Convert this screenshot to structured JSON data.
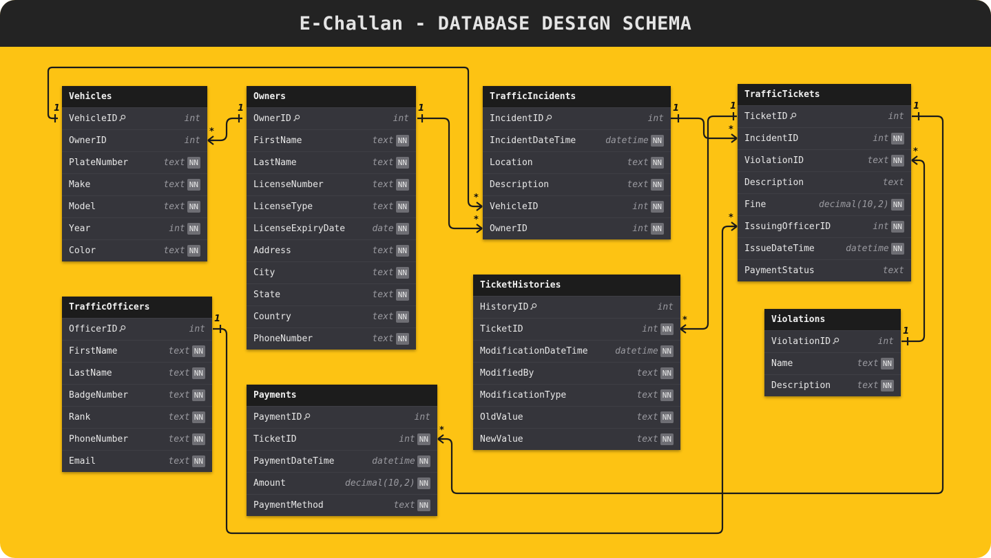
{
  "title": "E-Challan - DATABASE DESIGN SCHEMA",
  "colors": {
    "background": "#fdc313",
    "titlebar": "#232323",
    "table_body": "#35353b",
    "table_header": "#1c1c1c",
    "line": "#1a1a1a"
  },
  "key_icon": "key-icon",
  "nn_label": "NN",
  "tables": {
    "vehicles": {
      "name": "Vehicles",
      "fields": [
        {
          "name": "VehicleID",
          "type": "int",
          "pk": true,
          "nn": false
        },
        {
          "name": "OwnerID",
          "type": "int",
          "pk": false,
          "nn": false
        },
        {
          "name": "PlateNumber",
          "type": "text",
          "pk": false,
          "nn": true
        },
        {
          "name": "Make",
          "type": "text",
          "pk": false,
          "nn": true
        },
        {
          "name": "Model",
          "type": "text",
          "pk": false,
          "nn": true
        },
        {
          "name": "Year",
          "type": "int",
          "pk": false,
          "nn": true
        },
        {
          "name": "Color",
          "type": "text",
          "pk": false,
          "nn": true
        }
      ]
    },
    "owners": {
      "name": "Owners",
      "fields": [
        {
          "name": "OwnerID",
          "type": "int",
          "pk": true,
          "nn": false
        },
        {
          "name": "FirstName",
          "type": "text",
          "pk": false,
          "nn": true
        },
        {
          "name": "LastName",
          "type": "text",
          "pk": false,
          "nn": true
        },
        {
          "name": "LicenseNumber",
          "type": "text",
          "pk": false,
          "nn": true
        },
        {
          "name": "LicenseType",
          "type": "text",
          "pk": false,
          "nn": true
        },
        {
          "name": "LicenseExpiryDate",
          "type": "date",
          "pk": false,
          "nn": true
        },
        {
          "name": "Address",
          "type": "text",
          "pk": false,
          "nn": true
        },
        {
          "name": "City",
          "type": "text",
          "pk": false,
          "nn": true
        },
        {
          "name": "State",
          "type": "text",
          "pk": false,
          "nn": true
        },
        {
          "name": "Country",
          "type": "text",
          "pk": false,
          "nn": true
        },
        {
          "name": "PhoneNumber",
          "type": "text",
          "pk": false,
          "nn": true
        }
      ]
    },
    "incidents": {
      "name": "TrafficIncidents",
      "fields": [
        {
          "name": "IncidentID",
          "type": "int",
          "pk": true,
          "nn": false
        },
        {
          "name": "IncidentDateTime",
          "type": "datetime",
          "pk": false,
          "nn": true
        },
        {
          "name": "Location",
          "type": "text",
          "pk": false,
          "nn": true
        },
        {
          "name": "Description",
          "type": "text",
          "pk": false,
          "nn": true
        },
        {
          "name": "VehicleID",
          "type": "int",
          "pk": false,
          "nn": true
        },
        {
          "name": "OwnerID",
          "type": "int",
          "pk": false,
          "nn": true
        }
      ]
    },
    "tickets": {
      "name": "TrafficTickets",
      "fields": [
        {
          "name": "TicketID",
          "type": "int",
          "pk": true,
          "nn": false
        },
        {
          "name": "IncidentID",
          "type": "int",
          "pk": false,
          "nn": true
        },
        {
          "name": "ViolationID",
          "type": "text",
          "pk": false,
          "nn": true
        },
        {
          "name": "Description",
          "type": "text",
          "pk": false,
          "nn": false
        },
        {
          "name": "Fine",
          "type": "decimal(10,2)",
          "pk": false,
          "nn": true
        },
        {
          "name": "IssuingOfficerID",
          "type": "int",
          "pk": false,
          "nn": true
        },
        {
          "name": "IssueDateTime",
          "type": "datetime",
          "pk": false,
          "nn": true
        },
        {
          "name": "PaymentStatus",
          "type": "text",
          "pk": false,
          "nn": false
        }
      ]
    },
    "officers": {
      "name": "TrafficOfficers",
      "fields": [
        {
          "name": "OfficerID",
          "type": "int",
          "pk": true,
          "nn": false
        },
        {
          "name": "FirstName",
          "type": "text",
          "pk": false,
          "nn": true
        },
        {
          "name": "LastName",
          "type": "text",
          "pk": false,
          "nn": true
        },
        {
          "name": "BadgeNumber",
          "type": "text",
          "pk": false,
          "nn": true
        },
        {
          "name": "Rank",
          "type": "text",
          "pk": false,
          "nn": true
        },
        {
          "name": "PhoneNumber",
          "type": "text",
          "pk": false,
          "nn": true
        },
        {
          "name": "Email",
          "type": "text",
          "pk": false,
          "nn": true
        }
      ]
    },
    "histories": {
      "name": "TicketHistories",
      "fields": [
        {
          "name": "HistoryID",
          "type": "int",
          "pk": true,
          "nn": false
        },
        {
          "name": "TicketID",
          "type": "int",
          "pk": false,
          "nn": true
        },
        {
          "name": "ModificationDateTime",
          "type": "datetime",
          "pk": false,
          "nn": true
        },
        {
          "name": "ModifiedBy",
          "type": "text",
          "pk": false,
          "nn": true
        },
        {
          "name": "ModificationType",
          "type": "text",
          "pk": false,
          "nn": true
        },
        {
          "name": "OldValue",
          "type": "text",
          "pk": false,
          "nn": true
        },
        {
          "name": "NewValue",
          "type": "text",
          "pk": false,
          "nn": true
        }
      ]
    },
    "payments": {
      "name": "Payments",
      "fields": [
        {
          "name": "PaymentID",
          "type": "int",
          "pk": true,
          "nn": false
        },
        {
          "name": "TicketID",
          "type": "int",
          "pk": false,
          "nn": true
        },
        {
          "name": "PaymentDateTime",
          "type": "datetime",
          "pk": false,
          "nn": true
        },
        {
          "name": "Amount",
          "type": "decimal(10,2)",
          "pk": false,
          "nn": true
        },
        {
          "name": "PaymentMethod",
          "type": "text",
          "pk": false,
          "nn": true
        }
      ]
    },
    "violations": {
      "name": "Violations",
      "fields": [
        {
          "name": "ViolationID",
          "type": "int",
          "pk": true,
          "nn": false
        },
        {
          "name": "Name",
          "type": "text",
          "pk": false,
          "nn": true
        },
        {
          "name": "Description",
          "type": "text",
          "pk": false,
          "nn": true
        }
      ]
    }
  },
  "relationships": [
    {
      "from": "Owners.OwnerID",
      "from_card": "1",
      "to": "Vehicles.OwnerID",
      "to_card": "*"
    },
    {
      "from": "Vehicles.VehicleID",
      "from_card": "1",
      "to": "TrafficIncidents.VehicleID",
      "to_card": "*"
    },
    {
      "from": "Owners.OwnerID",
      "from_card": "1",
      "to": "TrafficIncidents.OwnerID",
      "to_card": "*"
    },
    {
      "from": "TrafficIncidents.IncidentID",
      "from_card": "1",
      "to": "TrafficTickets.IncidentID",
      "to_card": "*"
    },
    {
      "from": "Violations.ViolationID",
      "from_card": "1",
      "to": "TrafficTickets.ViolationID",
      "to_card": "*"
    },
    {
      "from": "TrafficOfficers.OfficerID",
      "from_card": "1",
      "to": "TrafficTickets.IssuingOfficerID",
      "to_card": "*"
    },
    {
      "from": "TrafficTickets.TicketID",
      "from_card": "1",
      "to": "TicketHistories.TicketID",
      "to_card": "*"
    },
    {
      "from": "TrafficTickets.TicketID",
      "from_card": "1",
      "to": "Payments.TicketID",
      "to_card": "*"
    }
  ]
}
